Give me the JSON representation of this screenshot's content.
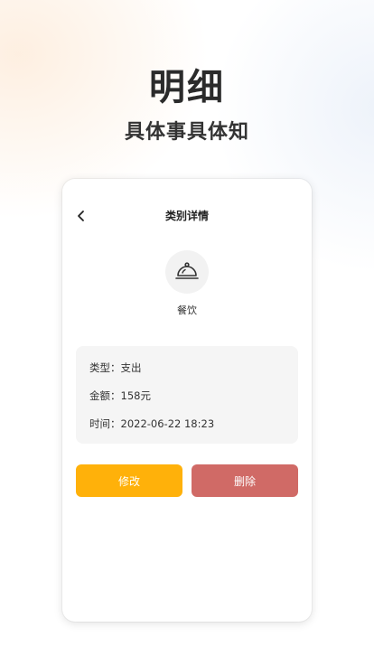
{
  "hero": {
    "title": "明细",
    "subtitle": "具体事具体知"
  },
  "screen": {
    "nav": {
      "back_icon": "chevron-left-icon",
      "title": "类别详情"
    },
    "category": {
      "icon": "food-cloche-icon",
      "name": "餐饮"
    },
    "details": {
      "type_label": "类型：",
      "type_value": "支出",
      "amount_label": "金额：",
      "amount_value": "158元",
      "time_label": "时间：",
      "time_value": "2022-06-22 18:23"
    },
    "actions": {
      "edit_label": "修改",
      "delete_label": "删除"
    }
  },
  "colors": {
    "edit_button": "#FFB10A",
    "delete_button": "#D06A66",
    "info_bg": "#F5F5F5"
  }
}
